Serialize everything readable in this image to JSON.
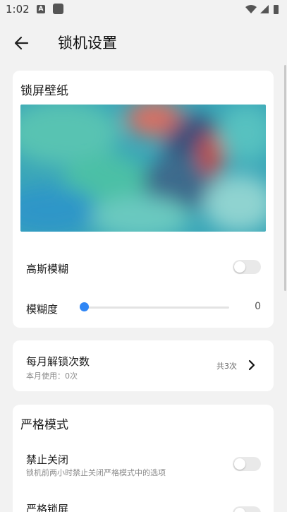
{
  "status": {
    "time": "1:02",
    "a_icon_text": "A"
  },
  "appbar": {
    "title": "锁机设置"
  },
  "wallpaper_card": {
    "title": "锁屏壁纸",
    "blur_label": "高斯模糊",
    "blur_enabled": false,
    "blur_degree_label": "模糊度",
    "blur_degree_value": "0"
  },
  "unlock_card": {
    "title": "每月解锁次数",
    "subtitle": "本月使用：0次",
    "total": "共3次"
  },
  "strict_card": {
    "title": "严格模式",
    "forbid_close_label": "禁止关闭",
    "forbid_close_desc": "锁机前两小时禁止关闭严格模式中的选项",
    "forbid_close_enabled": false,
    "strict_lock_label": "严格锁屏",
    "strict_lock_enabled": false
  }
}
